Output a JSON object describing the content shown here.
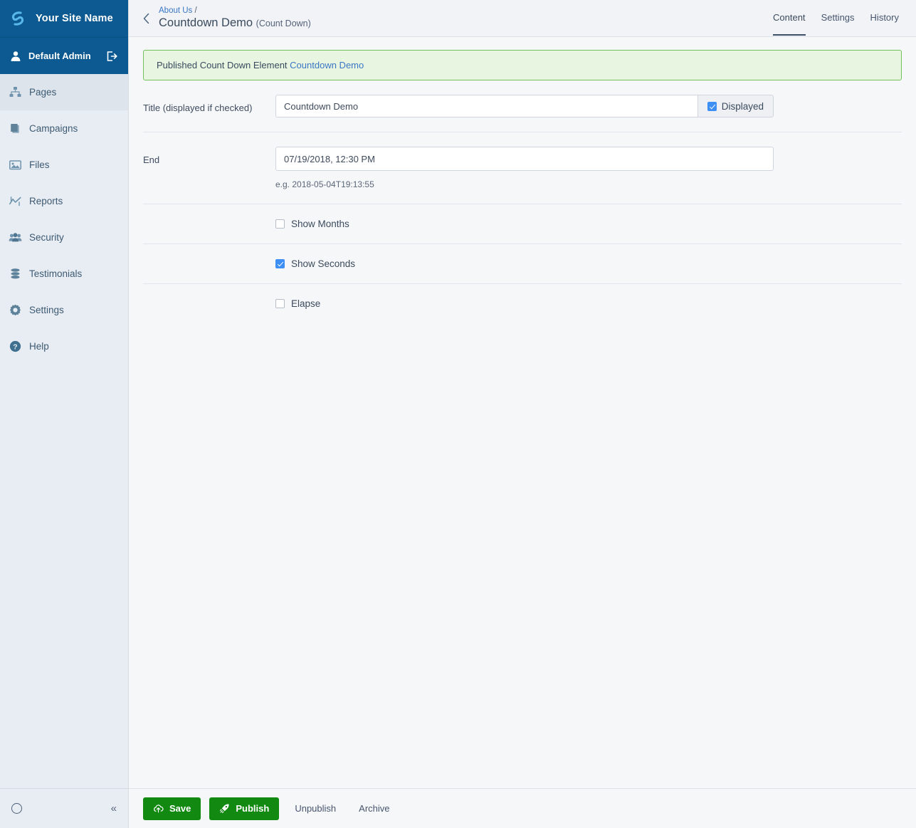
{
  "sidebar": {
    "logo_text": "Your Site Name",
    "logo_icon": "swirl-logo-icon",
    "user": {
      "name": "Default Admin",
      "avatar_icon": "user-icon",
      "logout_icon": "logout-icon"
    },
    "items": [
      {
        "label": "Pages",
        "icon": "sitemap-icon",
        "active": true
      },
      {
        "label": "Campaigns",
        "icon": "book-icon",
        "active": false
      },
      {
        "label": "Files",
        "icon": "image-icon",
        "active": false
      },
      {
        "label": "Reports",
        "icon": "chart-line-icon",
        "active": false
      },
      {
        "label": "Security",
        "icon": "users-icon",
        "active": false
      },
      {
        "label": "Testimonials",
        "icon": "database-icon",
        "active": false
      },
      {
        "label": "Settings",
        "icon": "gear-icon",
        "active": false
      },
      {
        "label": "Help",
        "icon": "question-circle-icon",
        "active": false
      }
    ],
    "footer": {
      "status_icon": "circle-icon",
      "collapse_icon": "double-chevron-left-icon",
      "collapse_label": "«"
    }
  },
  "header": {
    "back_icon": "chevron-left-icon",
    "breadcrumb_parent": "About Us",
    "breadcrumb_separator": "/",
    "title": "Countdown Demo",
    "title_type": "(Count Down)",
    "tabs": [
      {
        "label": "Content",
        "active": true
      },
      {
        "label": "Settings",
        "active": false
      },
      {
        "label": "History",
        "active": false
      }
    ]
  },
  "alert": {
    "text": "Published Count Down Element ",
    "link": "Countdown Demo",
    "bg": "#e8f5e0",
    "border": "#74c05a"
  },
  "form": {
    "title_row": {
      "label": "Title (displayed if checked)",
      "value": "Countdown Demo",
      "placeholder": "",
      "checkbox_label": "Displayed",
      "checked": true
    },
    "end_row": {
      "label": "End",
      "value": "07/19/2018, 12:30 PM",
      "placeholder": "",
      "hint": "e.g. 2018-05-04T19:13:55"
    },
    "checkboxes": [
      {
        "label": "Show Months",
        "checked": false
      },
      {
        "label": "Show Seconds",
        "checked": true
      },
      {
        "label": "Elapse",
        "checked": false
      }
    ]
  },
  "actions": {
    "save": {
      "label": "Save",
      "icon": "cloud-upload-icon"
    },
    "publish": {
      "label": "Publish",
      "icon": "rocket-icon"
    },
    "unpublish": {
      "label": "Unpublish"
    },
    "archive": {
      "label": "Archive"
    },
    "primary_color": "#128a12"
  }
}
